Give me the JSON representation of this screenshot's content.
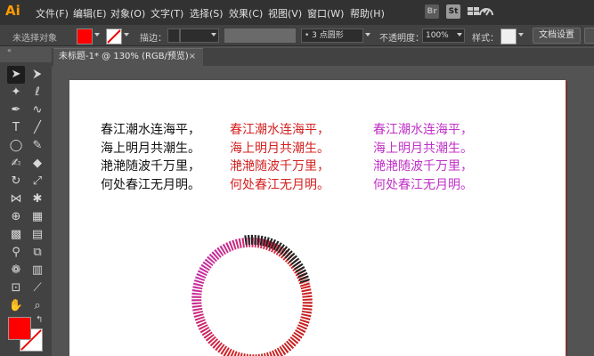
{
  "app": {
    "logo": "Ai"
  },
  "menu": [
    "文件(F)",
    "编辑(E)",
    "对象(O)",
    "文字(T)",
    "选择(S)",
    "效果(C)",
    "视图(V)",
    "窗口(W)",
    "帮助(H)"
  ],
  "menubar_icons": {
    "bridge": "Br",
    "stock": "St"
  },
  "control": {
    "selection": "未选择对象",
    "fill_color": "#ff0000",
    "stroke_label": "描边：",
    "brush": "3 点圆形",
    "opacity_label": "不透明度：",
    "opacity_value": "100%",
    "style_label": "样式：",
    "doc_setup": "文档设置"
  },
  "document": {
    "tab": "未标题-1* @ 130% (RGB/预览)"
  },
  "poem": {
    "lines": [
      "春江潮水连海平，",
      "海上明月共潮生。",
      "滟滟随波千万里，",
      "何处春江无月明。"
    ],
    "colors": [
      "#111111",
      "#d42020",
      "#c030c8"
    ]
  },
  "tools": [
    "selection-icon",
    "direct-selection-icon",
    "magic-wand-icon",
    "lasso-icon",
    "pen-icon",
    "curvature-icon",
    "type-icon",
    "line-icon",
    "rectangle-icon",
    "paintbrush-icon",
    "shaper-icon",
    "eraser-icon",
    "rotate-icon",
    "scale-icon",
    "width-icon",
    "puppet-warp-icon",
    "shape-builder-icon",
    "perspective-icon",
    "mesh-icon",
    "gradient-icon",
    "eyedropper-icon",
    "blend-icon",
    "symbol-sprayer-icon",
    "column-graph-icon",
    "artboard-icon",
    "slice-icon",
    "hand-icon",
    "zoom-icon"
  ],
  "fill_stroke": {
    "fill": "#ff0000",
    "stroke": "#ffffff"
  }
}
